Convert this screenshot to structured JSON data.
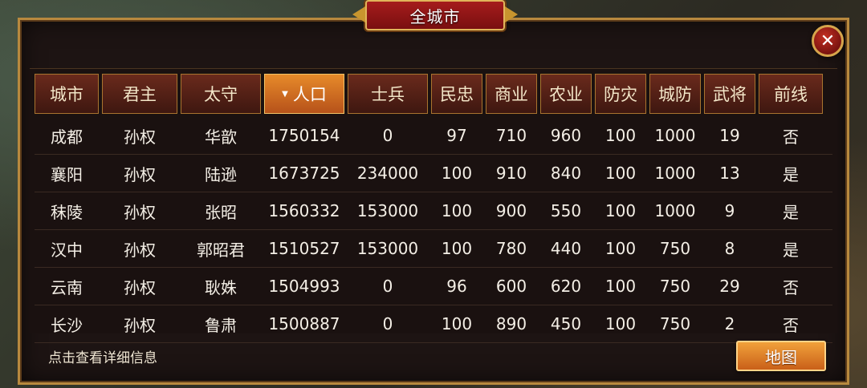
{
  "title": "全城市",
  "columns": [
    "城市",
    "君主",
    "太守",
    "人口",
    "士兵",
    "民忠",
    "商业",
    "农业",
    "防灾",
    "城防",
    "武将",
    "前线"
  ],
  "sort_column": "人口",
  "rows": [
    [
      "成都",
      "孙权",
      "华歆",
      "1750154",
      "0",
      "97",
      "710",
      "960",
      "100",
      "1000",
      "19",
      "否"
    ],
    [
      "襄阳",
      "孙权",
      "陆逊",
      "1673725",
      "234000",
      "100",
      "910",
      "840",
      "100",
      "1000",
      "13",
      "是"
    ],
    [
      "秣陵",
      "孙权",
      "张昭",
      "1560332",
      "153000",
      "100",
      "900",
      "550",
      "100",
      "1000",
      "9",
      "是"
    ],
    [
      "汉中",
      "孙权",
      "郭昭君",
      "1510527",
      "153000",
      "100",
      "780",
      "440",
      "100",
      "750",
      "8",
      "是"
    ],
    [
      "云南",
      "孙权",
      "耿姝",
      "1504993",
      "0",
      "96",
      "600",
      "620",
      "100",
      "750",
      "29",
      "否"
    ],
    [
      "长沙",
      "孙权",
      "鲁肃",
      "1500887",
      "0",
      "100",
      "890",
      "450",
      "100",
      "750",
      "2",
      "否"
    ]
  ],
  "footer_hint": "点击查看详细信息",
  "map_button": "地图",
  "close_icon": "close-icon",
  "sort_icon": "sort-desc-icon",
  "colors": {
    "accent": "#e78a2a",
    "title_red": "#a51c1c",
    "gold": "#b8893e"
  }
}
